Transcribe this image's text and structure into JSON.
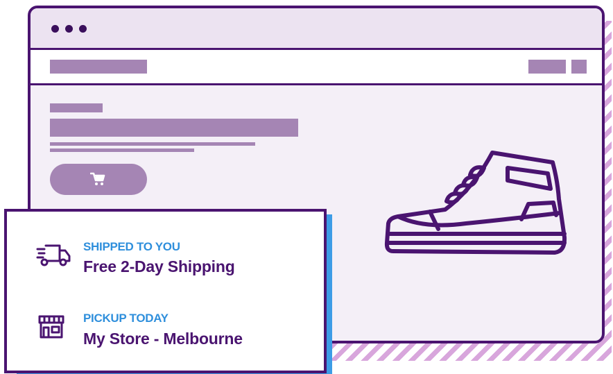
{
  "shipping": {
    "kicker": "SHIPPED TO YOU",
    "title": "Free 2-Day Shipping",
    "icon": "delivery-truck-icon"
  },
  "pickup": {
    "kicker": "PICKUP TODAY",
    "title": "My Store - Melbourne",
    "icon": "storefront-icon"
  },
  "product": {
    "image": "sneaker-icon",
    "cart_icon": "shopping-cart-icon"
  },
  "colors": {
    "primary": "#4a1470",
    "accent": "#3d9ce6",
    "placeholder": "#a585b4",
    "stripe": "#d8a6dc"
  }
}
